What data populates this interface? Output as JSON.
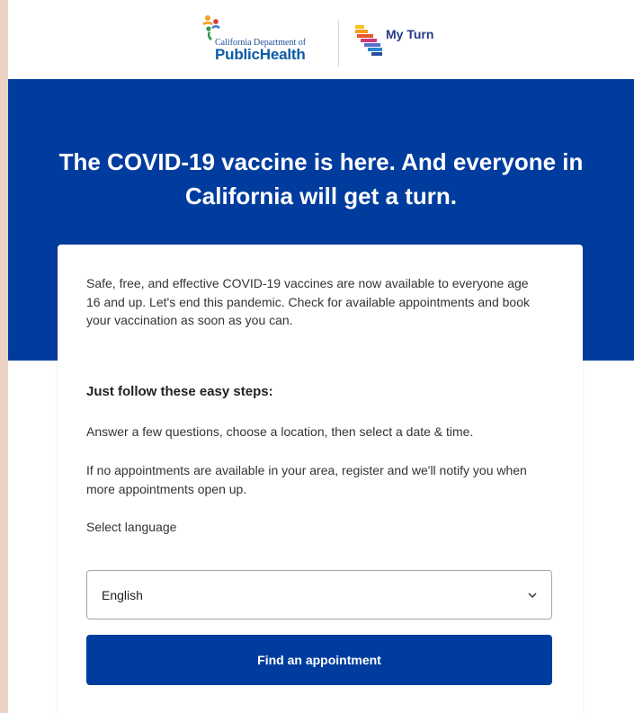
{
  "header": {
    "cdph_logo": {
      "small_text": "California Department of",
      "big_text": "PublicHealth",
      "icon": "cdph-figures-icon"
    },
    "myturn_logo": {
      "text": "My Turn",
      "icon": "california-stripes-icon"
    }
  },
  "hero": {
    "title": "The COVID-19 vaccine is here. And everyone in California will get a turn."
  },
  "card": {
    "intro": "Safe, free, and effective COVID-19 vaccines are now available to everyone age 16 and up. Let's end this pandemic. Check for available appointments and book your vaccination as soon as you can.",
    "steps_title": "Just follow these easy steps:",
    "step_line_1": "Answer a few questions, choose a location, then select a date & time.",
    "step_line_2": "If no appointments are available in your area, register and we'll notify you when more appointments open up.",
    "language_label": "Select language",
    "language_selected": "English",
    "find_button": "Find an appointment"
  },
  "colors": {
    "primary_blue": "#003c9e",
    "page_bg": "#ecd3c4"
  }
}
